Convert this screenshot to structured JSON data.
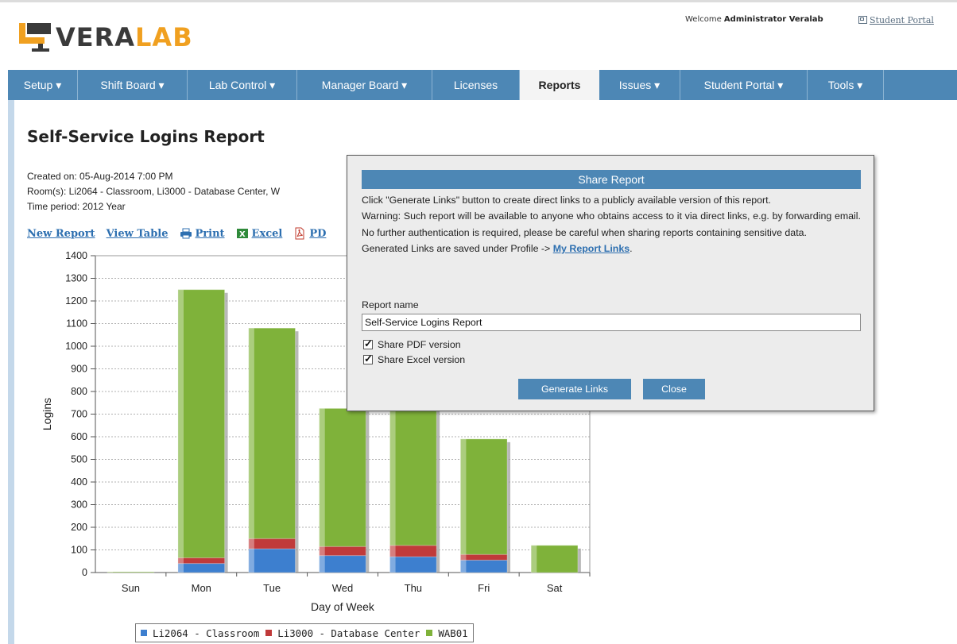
{
  "header": {
    "logo_prefix": "VERA",
    "logo_suffix": "LAB",
    "welcome_prefix": "Welcome ",
    "welcome_user": "Administrator Veralab",
    "student_portal_link": "Student Portal"
  },
  "nav": {
    "items": [
      {
        "label": "Setup ▾"
      },
      {
        "label": "Shift Board ▾"
      },
      {
        "label": "Lab Control ▾"
      },
      {
        "label": "Manager Board ▾"
      },
      {
        "label": "Licenses"
      },
      {
        "label": "Reports"
      },
      {
        "label": "Issues ▾"
      },
      {
        "label": "Student Portal ▾"
      },
      {
        "label": "Tools ▾"
      }
    ],
    "active_index": 5
  },
  "report": {
    "title": "Self-Service Logins Report",
    "created_on": "Created on: 05-Aug-2014 7:00 PM",
    "rooms": "Room(s): Li2064 - Classroom, Li3000 - Database Center, W",
    "time_period": "Time period: 2012 Year",
    "links": {
      "new_report": "New Report",
      "view_table": "View Table",
      "print": "Print",
      "excel": "Excel",
      "pdf": "PD"
    }
  },
  "dialog": {
    "title": "Share Report",
    "paragraph1": "Click \"Generate Links\" button to create direct links to a publicly available version of this report.",
    "paragraph2": "Warning: Such report will be available to anyone who obtains access to it via direct links, e.g. by forwarding email. No further authentication is required, please be careful when sharing reports containing sensitive data.",
    "saved_prefix": "Generated Links are saved under Profile -> ",
    "saved_link": "My Report Links",
    "saved_suffix": ".",
    "report_name_label": "Report name",
    "report_name_value": "Self-Service Logins Report",
    "share_pdf_label": "Share PDF version",
    "share_pdf_checked": true,
    "share_excel_label": "Share Excel version",
    "share_excel_checked": true,
    "generate_button": "Generate Links",
    "close_button": "Close"
  },
  "chart_data": {
    "type": "bar",
    "stacked": true,
    "categories": [
      "Sun",
      "Mon",
      "Tue",
      "Wed",
      "Thu",
      "Fri",
      "Sat"
    ],
    "series": [
      {
        "name": "Li2064 - Classroom",
        "color": "#3d7fcf",
        "values": [
          0,
          40,
          105,
          75,
          70,
          55,
          0
        ]
      },
      {
        "name": "Li3000 - Database Center",
        "color": "#c03a3a",
        "values": [
          0,
          25,
          45,
          40,
          50,
          25,
          0
        ]
      },
      {
        "name": "WAB01",
        "color": "#7fb23a",
        "values": [
          3,
          1185,
          930,
          610,
          620,
          510,
          120
        ]
      }
    ],
    "xlabel": "Day of Week",
    "ylabel": "Logins",
    "ylim": [
      0,
      1400
    ],
    "yticks": [
      0,
      100,
      200,
      300,
      400,
      500,
      600,
      700,
      800,
      900,
      1000,
      1100,
      1200,
      1300,
      1400
    ],
    "grid": true,
    "legend_position": "bottom"
  }
}
